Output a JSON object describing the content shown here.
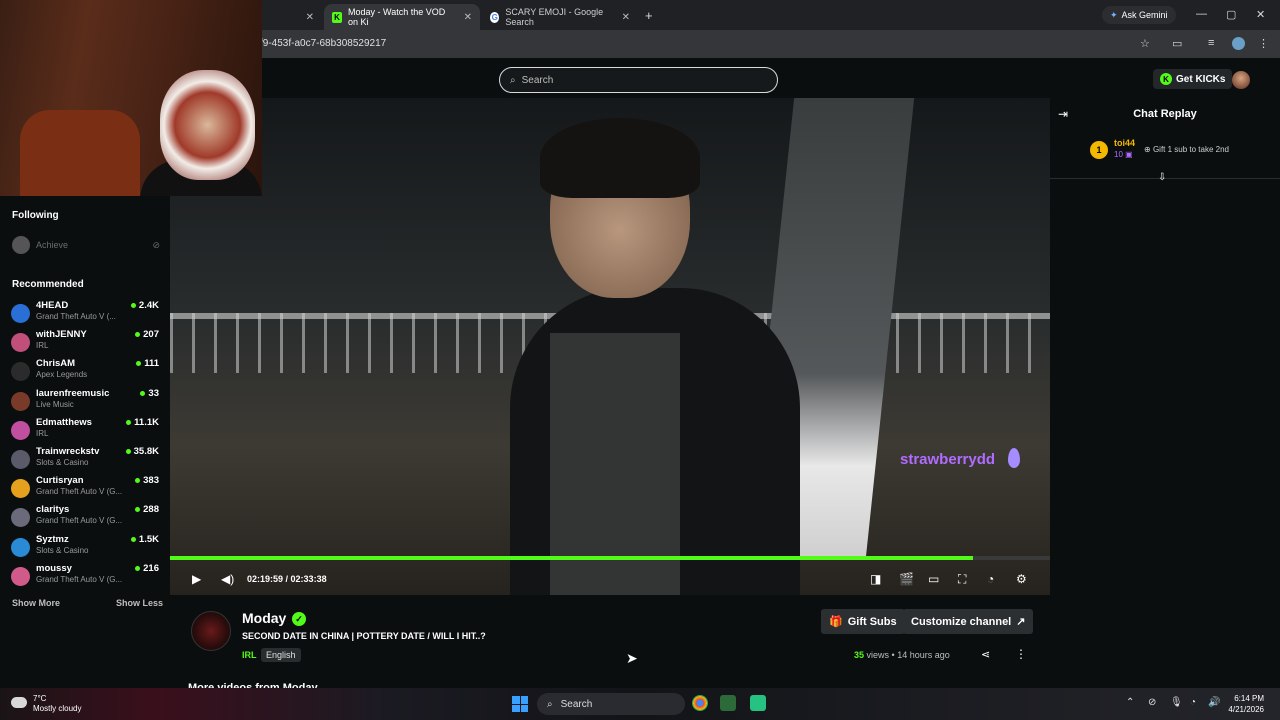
{
  "browser": {
    "tabs": [
      {
        "label": "Moday - Watch the VOD on Ki",
        "active": true
      },
      {
        "label": "SCARY EMOJI - Google Search",
        "active": false
      }
    ],
    "url": "f9-453f-a0c7-68b308529217",
    "ask_gemini": "Ask Gemini"
  },
  "header": {
    "search_placeholder": "Search",
    "get_kicks": "Get KICKs"
  },
  "sidebar": {
    "following_title": "Following",
    "following_item": "Achieve",
    "recommended_title": "Recommended",
    "recommended": [
      {
        "name": "4HEAD",
        "category": "Grand Theft Auto V (...",
        "viewers": "2.4K",
        "color": "#2a6fd6"
      },
      {
        "name": "withJENNY",
        "category": "IRL",
        "viewers": "207",
        "color": "#c04f7a"
      },
      {
        "name": "ChrisAM",
        "category": "Apex Legends",
        "viewers": "111",
        "color": "#2b2b2b"
      },
      {
        "name": "laurenfreemusic",
        "category": "Live Music",
        "viewers": "33",
        "color": "#7a3a2a"
      },
      {
        "name": "Edmatthews",
        "category": "IRL",
        "viewers": "11.1K",
        "color": "#c04fa0"
      },
      {
        "name": "Trainwreckstv",
        "category": "Slots & Casino",
        "viewers": "35.8K",
        "color": "#5a5a6a"
      },
      {
        "name": "Curtisryan",
        "category": "Grand Theft Auto V (G...",
        "viewers": "383",
        "color": "#e5a11e"
      },
      {
        "name": "claritys",
        "category": "Grand Theft Auto V (G...",
        "viewers": "288",
        "color": "#6a6a7a"
      },
      {
        "name": "Syztmz",
        "category": "Slots & Casino",
        "viewers": "1.5K",
        "color": "#2a8ad6"
      },
      {
        "name": "moussy",
        "category": "Grand Theft Auto V (G...",
        "viewers": "216",
        "color": "#d05a8a"
      }
    ],
    "show_more": "Show More",
    "show_less": "Show Less"
  },
  "player": {
    "overlay_username": "strawberrydd",
    "current_time": "02:19:59",
    "duration": "02:33:38",
    "progress": 0.912
  },
  "chat": {
    "title": "Chat Replay",
    "gift": {
      "rank": "1",
      "user": "toi44",
      "count": "10",
      "text": "Gift 1 sub to take 2nd"
    }
  },
  "channel": {
    "name": "Moday",
    "vod_title": "SECOND DATE IN CHINA | POTTERY DATE / WILL I HIT..?",
    "category": "IRL",
    "language": "English",
    "gift_subs": "Gift Subs",
    "customize": "Customize channel",
    "views_count": "35",
    "views_label": "views",
    "ago": "14 hours ago",
    "more_videos": "More videos from Moday"
  },
  "taskbar": {
    "temp": "7°C",
    "weather": "Mostly cloudy",
    "search": "Search",
    "time": "6:14 PM",
    "date": "4/21/2026"
  },
  "colors": {
    "kick_green": "#53fc18",
    "overlay_purple": "#b06bff",
    "gift_gold": "#f5b800"
  }
}
